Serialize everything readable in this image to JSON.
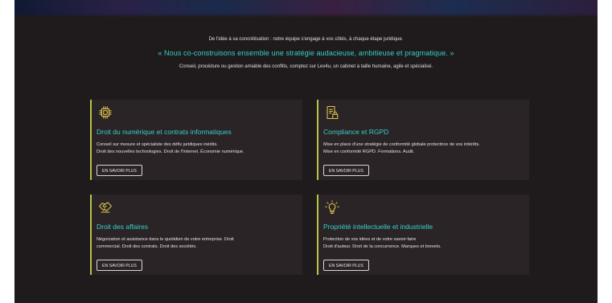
{
  "intro": {
    "line1": "De l'idée à sa concrétisation : notre équipe s'engage à vos côtés, à chaque étape juridique.",
    "quote": "« Nous co-construisons ensemble une stratégie audacieuse, ambitieuse et pragmatique. »",
    "line3": "Conseil, procédure ou gestion amiable des conflits, comptez sur Lex4u, un cabinet à taille humaine, agile et spécialisé."
  },
  "colors": {
    "accent": "#35d1c7",
    "card_border": "#b9c24a",
    "icon": "#e0c64a",
    "background": "#1f1a1c",
    "card": "#2b2427"
  },
  "cards": [
    {
      "icon": "chip-icon",
      "title": "Droit du numérique et contrats informatiques",
      "desc1": "Conseil sur mesure et spécialiste des défis juridiques inédits.",
      "desc2": "Droit des nouvelles technologies. Droit de l'Internet. Économie numérique.",
      "button": "EN SAVOIR PLUS"
    },
    {
      "icon": "document-lock-icon",
      "title": "Compliance et RGPD",
      "desc1": "Mise en place d'une stratégie de conformité globale protectrice de vos intérêts.",
      "desc2": "Mise en conformité RGPD. Formations. Audit.",
      "button": "EN SAVOIR PLUS"
    },
    {
      "icon": "handshake-icon",
      "title": "Droit des affaires",
      "desc1": "Négociation et assistance dans le quotidien de votre entreprise. Droit",
      "desc2": "commercial. Droit des contrats. Droit des sociétés.",
      "button": "EN SAVOIR PLUS"
    },
    {
      "icon": "lightbulb-icon",
      "title": "Propriété intellectuelle et industrielle",
      "desc1": "Protection de vos idées et de votre savoir-faire",
      "desc2": "Droit d'auteur. Droit de la concurrence. Marques et brevets.",
      "button": "EN SAVOIR PLUS"
    }
  ]
}
